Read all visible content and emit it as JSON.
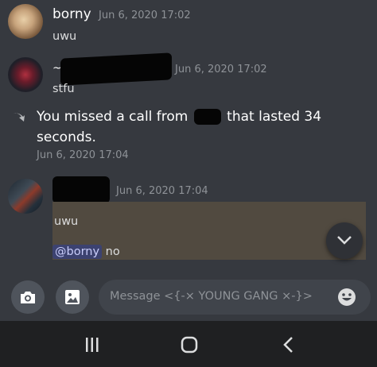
{
  "messages": [
    {
      "username": "borny",
      "timestamp": "Jun 6, 2020 17:02",
      "text": "uwu"
    },
    {
      "username": "~",
      "timestamp": "Jun 6, 2020 17:02",
      "text": "stfu"
    },
    {
      "username": "",
      "timestamp": "Jun 6, 2020 17:04"
    }
  ],
  "call": {
    "prefix": "You missed a call from",
    "suffix": "that lasted 34",
    "line2": "seconds.",
    "timestamp": "Jun 6, 2020 17:04"
  },
  "reply_embed": {
    "quoted_text": "uwu",
    "mention": "@borny",
    "reply_text": "no"
  },
  "composer": {
    "placeholder": "Message <{-× YOUNG GANG ×-}>"
  },
  "icons": {
    "camera": "camera-icon",
    "image": "image-icon",
    "emoji": "emoji-icon",
    "scroll_down": "chevron-down-icon",
    "call": "missed-call-icon",
    "nav_recents": "recents-icon",
    "nav_home": "home-icon",
    "nav_back": "back-icon"
  },
  "colors": {
    "background": "#36393f",
    "embed": "#514a40",
    "mention_bg": "#3c4270",
    "mention_text": "#c9cdfb"
  }
}
